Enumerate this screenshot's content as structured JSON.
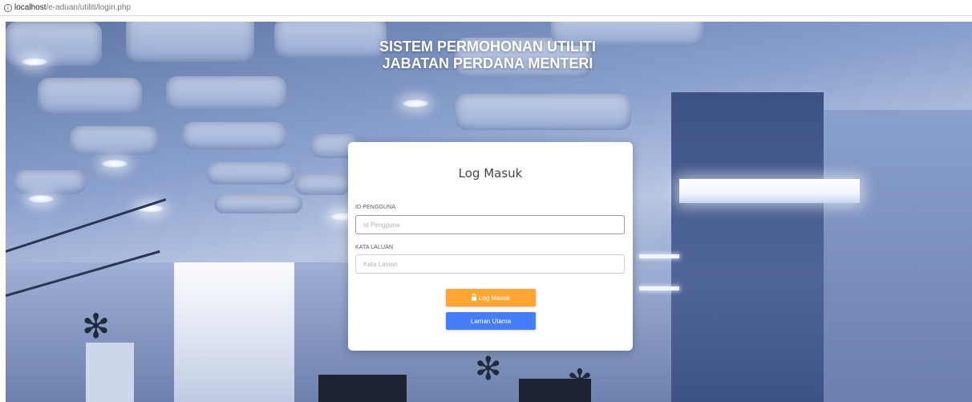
{
  "browser": {
    "url_host": "localhost",
    "url_path": "/e-aduan/utiliti/login.php",
    "info_icon": "info-icon"
  },
  "header": {
    "title_line1": "SISTEM PERMOHONAN UTILITI",
    "title_line2": "JABATAN PERDANA MENTERI"
  },
  "login": {
    "title": "Log Masuk",
    "username_label": "ID PENGGUNA",
    "username_placeholder": "Id Pengguna",
    "password_label": "KATA LALUAN",
    "password_placeholder": "Kata Laluan",
    "login_button": "Log Masuk",
    "login_icon": "lock-icon",
    "home_button": "Laman Utama"
  },
  "colors": {
    "login_button": "#ffa534",
    "home_button": "#447df7",
    "title_text": "#ffffff"
  }
}
